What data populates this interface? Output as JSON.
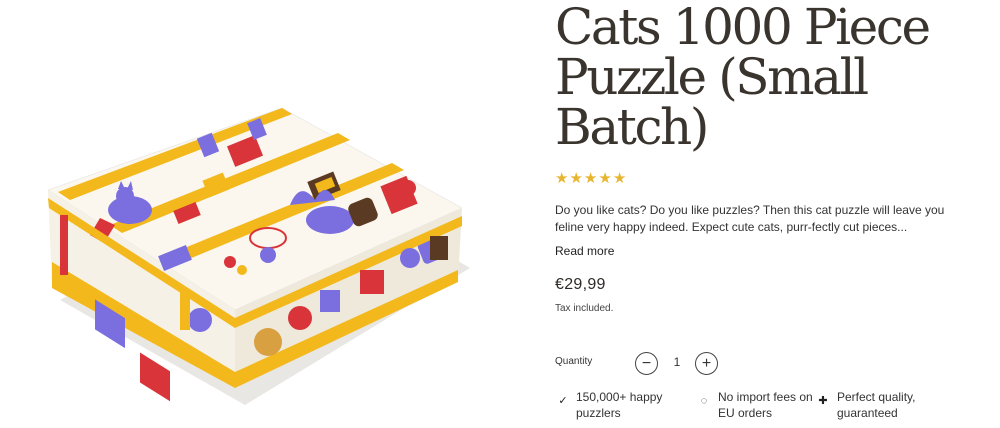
{
  "product": {
    "title": "Cats 1000 Piece Puzzle (Small Batch)",
    "rating_stars": 5,
    "star_glyph": "★",
    "description": "Do you like cats? Do you like puzzles? Then this cat puzzle will leave you feline very happy indeed. Expect cute cats, purr-fectly cut pieces...",
    "read_more_label": "Read more",
    "price": "€29,99",
    "tax_note": "Tax included.",
    "image_icon": "cats-puzzle-box-image"
  },
  "quantity": {
    "label": "Quantity",
    "value": "1",
    "minus_glyph": "−",
    "plus_glyph": "+"
  },
  "features": [
    {
      "icon": "check-icon",
      "glyph": "✓",
      "text": "150,000+ happy puzzlers"
    },
    {
      "icon": "dotted-circle-icon",
      "glyph": "◌",
      "text": "No import fees on EU orders"
    },
    {
      "icon": "puzzle-piece-icon",
      "glyph": "✚",
      "text": "Perfect quality, guaranteed"
    }
  ],
  "colors": {
    "accent_star": "#e8b530",
    "box_yellow": "#f2b81c",
    "box_purple": "#7b6fe0",
    "box_red": "#d8343a",
    "text": "#2e2a26"
  }
}
